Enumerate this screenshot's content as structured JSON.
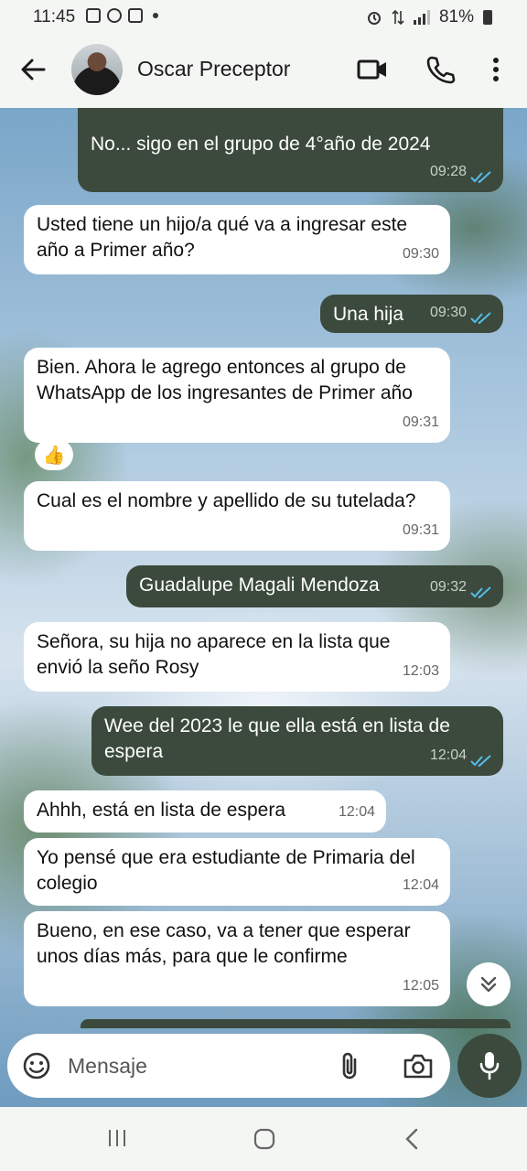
{
  "status_bar": {
    "time": "11:45",
    "battery": "81%"
  },
  "header": {
    "contact_name": "Oscar Preceptor",
    "icons": [
      "back-arrow-icon",
      "video-call-icon",
      "voice-call-icon",
      "more-options-icon"
    ]
  },
  "colors": {
    "outgoing_bubble": "#3b4a3c",
    "incoming_bubble": "#ffffff",
    "read_ticks": "#53bdeb"
  },
  "messages": [
    {
      "dir": "out",
      "text": "No... sigo en el grupo de 4°año de 2024",
      "time": "09:28",
      "read": true
    },
    {
      "dir": "in",
      "text": "Usted tiene un hijo/a qué va a ingresar este año a Primer año?",
      "time": "09:30"
    },
    {
      "dir": "out",
      "text": "Una hija",
      "time": "09:30",
      "read": true
    },
    {
      "dir": "in",
      "text": "Bien. Ahora le agrego entonces al grupo de WhatsApp de los ingresantes de Primer año",
      "time": "09:31",
      "reaction": "👍"
    },
    {
      "dir": "in",
      "text": "Cual es el nombre y apellido de su tutelada?",
      "time": "09:31"
    },
    {
      "dir": "out",
      "text": "Guadalupe Magali Mendoza",
      "time": "09:32",
      "read": true
    },
    {
      "dir": "in",
      "text": "Señora, su hija no aparece en la lista que envió la seño Rosy",
      "time": "12:03"
    },
    {
      "dir": "out",
      "text": "Wee del 2023 le que ella está en lista de espera",
      "time": "12:04",
      "read": true
    },
    {
      "dir": "in",
      "text": "Ahhh, está en lista de espera",
      "time": "12:04"
    },
    {
      "dir": "in",
      "text": "Yo pensé que era estudiante de Primaria del colegio",
      "time": "12:04"
    },
    {
      "dir": "in",
      "text": "Bueno, en ese caso, va a tener que esperar unos días más, para que le confirme",
      "time": "12:05"
    }
  ],
  "input": {
    "placeholder": "Mensaje"
  }
}
